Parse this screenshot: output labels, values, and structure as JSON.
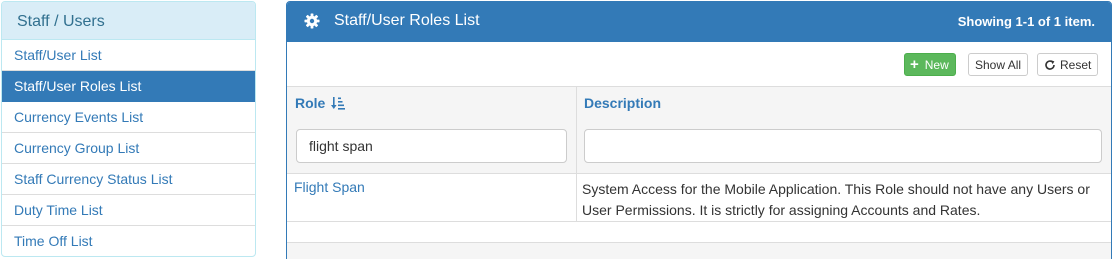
{
  "sidebar": {
    "heading": "Staff / Users",
    "items": [
      {
        "label": "Staff/User List"
      },
      {
        "label": "Staff/User Roles List"
      },
      {
        "label": "Currency Events List"
      },
      {
        "label": "Currency Group List"
      },
      {
        "label": "Staff Currency Status List"
      },
      {
        "label": "Duty Time List"
      },
      {
        "label": "Time Off List"
      }
    ],
    "active_index": 1
  },
  "panel": {
    "title": "Staff/User Roles List",
    "title_icon": "gear-icon",
    "summary": "Showing 1-1 of 1 item."
  },
  "toolbar": {
    "new_label": "New",
    "show_all_label": "Show All",
    "reset_label": "Reset"
  },
  "grid": {
    "columns": [
      {
        "label": "Role",
        "sort_icon": "sort-amount-down-icon"
      },
      {
        "label": "Description"
      }
    ],
    "filters": {
      "role_value": "flight span",
      "description_value": ""
    },
    "rows": [
      {
        "role": "Flight Span",
        "description": "System Access for the Mobile Application. This Role should not have any Users or User Permissions. It is strictly for assigning Accounts and Rates."
      }
    ]
  },
  "colors": {
    "primary": "#337ab7",
    "success": "#5cb85c",
    "info_bg": "#d9edf7",
    "info_text": "#31708f"
  }
}
